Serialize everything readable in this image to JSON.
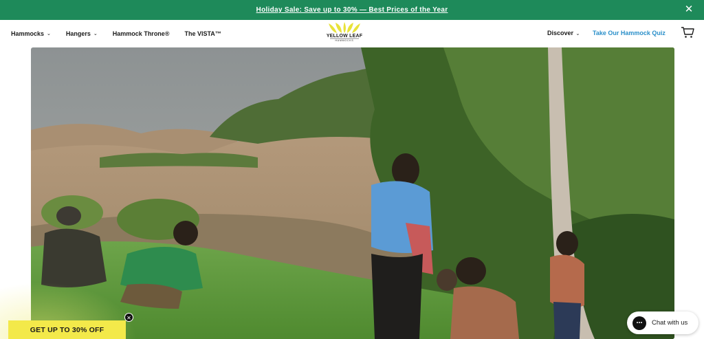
{
  "announcement": {
    "text": "Holiday Sale: Save up to 30% — Best Prices of the Year",
    "close_icon": "close-icon"
  },
  "nav": {
    "left_items": [
      {
        "label": "Hammocks",
        "has_dropdown": true
      },
      {
        "label": "Hangers",
        "has_dropdown": true
      },
      {
        "label": "Hammock Throne®",
        "has_dropdown": false
      },
      {
        "label": "The VISTA™",
        "has_dropdown": false
      }
    ],
    "logo": {
      "text": "YELLOW LEAF",
      "subtext": "HAMMOCKS"
    },
    "discover_label": "Discover",
    "quiz_label": "Take Our Hammock Quiz",
    "cart_icon": "cart-icon"
  },
  "promo": {
    "label": "GET UP TO 30% OFF"
  },
  "chat": {
    "label": "Chat with us"
  },
  "colors": {
    "announcement_bg": "#1e8a5a",
    "quiz_link": "#2a8fc9",
    "promo_bg": "#f3e94a",
    "logo_yellow": "#e8e23a"
  }
}
